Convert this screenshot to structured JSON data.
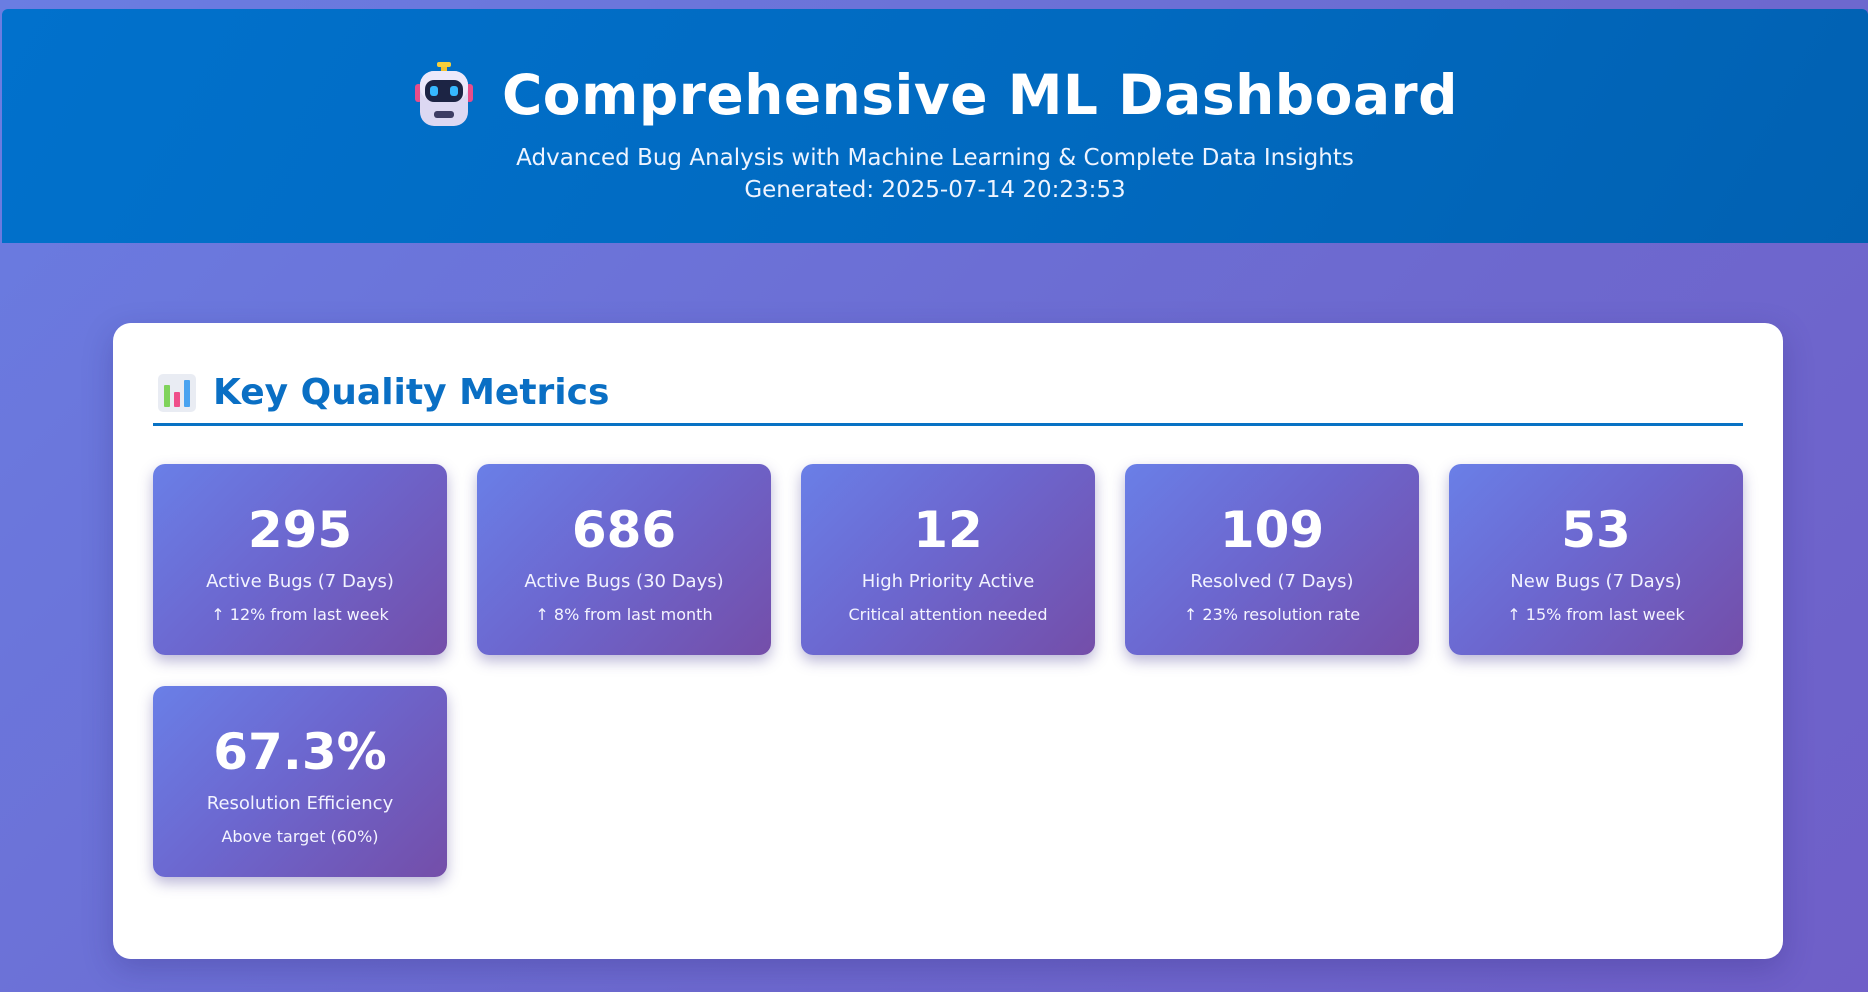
{
  "header": {
    "title": "Comprehensive ML Dashboard",
    "subtitle": "Advanced Bug Analysis with Machine Learning & Complete Data Insights",
    "generated": "Generated: 2025-07-14 20:23:53",
    "icon": "robot-icon"
  },
  "metrics_section": {
    "title": "Key Quality Metrics",
    "icon": "bar-chart-icon",
    "cards": [
      {
        "value": "295",
        "label": "Active Bugs (7 Days)",
        "note": "↑ 12% from last week"
      },
      {
        "value": "686",
        "label": "Active Bugs (30 Days)",
        "note": "↑ 8% from last month"
      },
      {
        "value": "12",
        "label": "High Priority Active",
        "note": "Critical attention needed"
      },
      {
        "value": "109",
        "label": "Resolved (7 Days)",
        "note": "↑ 23% resolution rate"
      },
      {
        "value": "53",
        "label": "New Bugs (7 Days)",
        "note": "↑ 15% from last week"
      },
      {
        "value": "67.3%",
        "label": "Resolution Efficiency",
        "note": "Above target (60%)"
      }
    ]
  },
  "colors": {
    "header_blue": "#016ac0",
    "accent_blue": "#0a6fc4",
    "card_start": "#6a7fe7",
    "card_end": "#744ea9",
    "page_bg": "#6d69cf"
  }
}
